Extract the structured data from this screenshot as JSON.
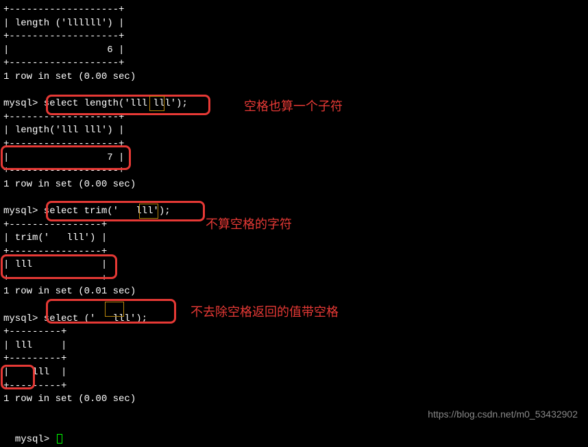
{
  "lines": {
    "l1": "+-------------------+",
    "l2": "| length ('llllll') |",
    "l3": "+-------------------+",
    "l4": "|                 6 |",
    "l5": "+-------------------+",
    "l6": "1 row in set (0.00 sec)",
    "l7": "",
    "l8": "mysql> select length('lll lll');",
    "l9": "+-------------------+",
    "l10": "| length('lll lll') |",
    "l11": "+-------------------+",
    "l12": "|                 7 |",
    "l13": "+-------------------+",
    "l14": "1 row in set (0.00 sec)",
    "l15": "",
    "l16": "mysql> select trim('   lll');",
    "l17": "+----------------+",
    "l18": "| trim('   lll') |",
    "l19": "+----------------+",
    "l20": "| lll            |",
    "l21": "+----------------+",
    "l22": "1 row in set (0.01 sec)",
    "l23": "",
    "l24": "mysql> select ('   lll');",
    "l25": "+---------+",
    "l26": "| lll     |",
    "l27": "+---------+",
    "l28": "|    lll  |",
    "l29": "+---------+",
    "l30": "1 row in set (0.00 sec)",
    "l31": "",
    "l32": "mysql> "
  },
  "annotations": {
    "a1": "空格也算一个子符",
    "a2": "不算空格的字符",
    "a3": "不去除空格返回的值带空格"
  },
  "watermark": "https://blog.csdn.net/m0_53432902"
}
